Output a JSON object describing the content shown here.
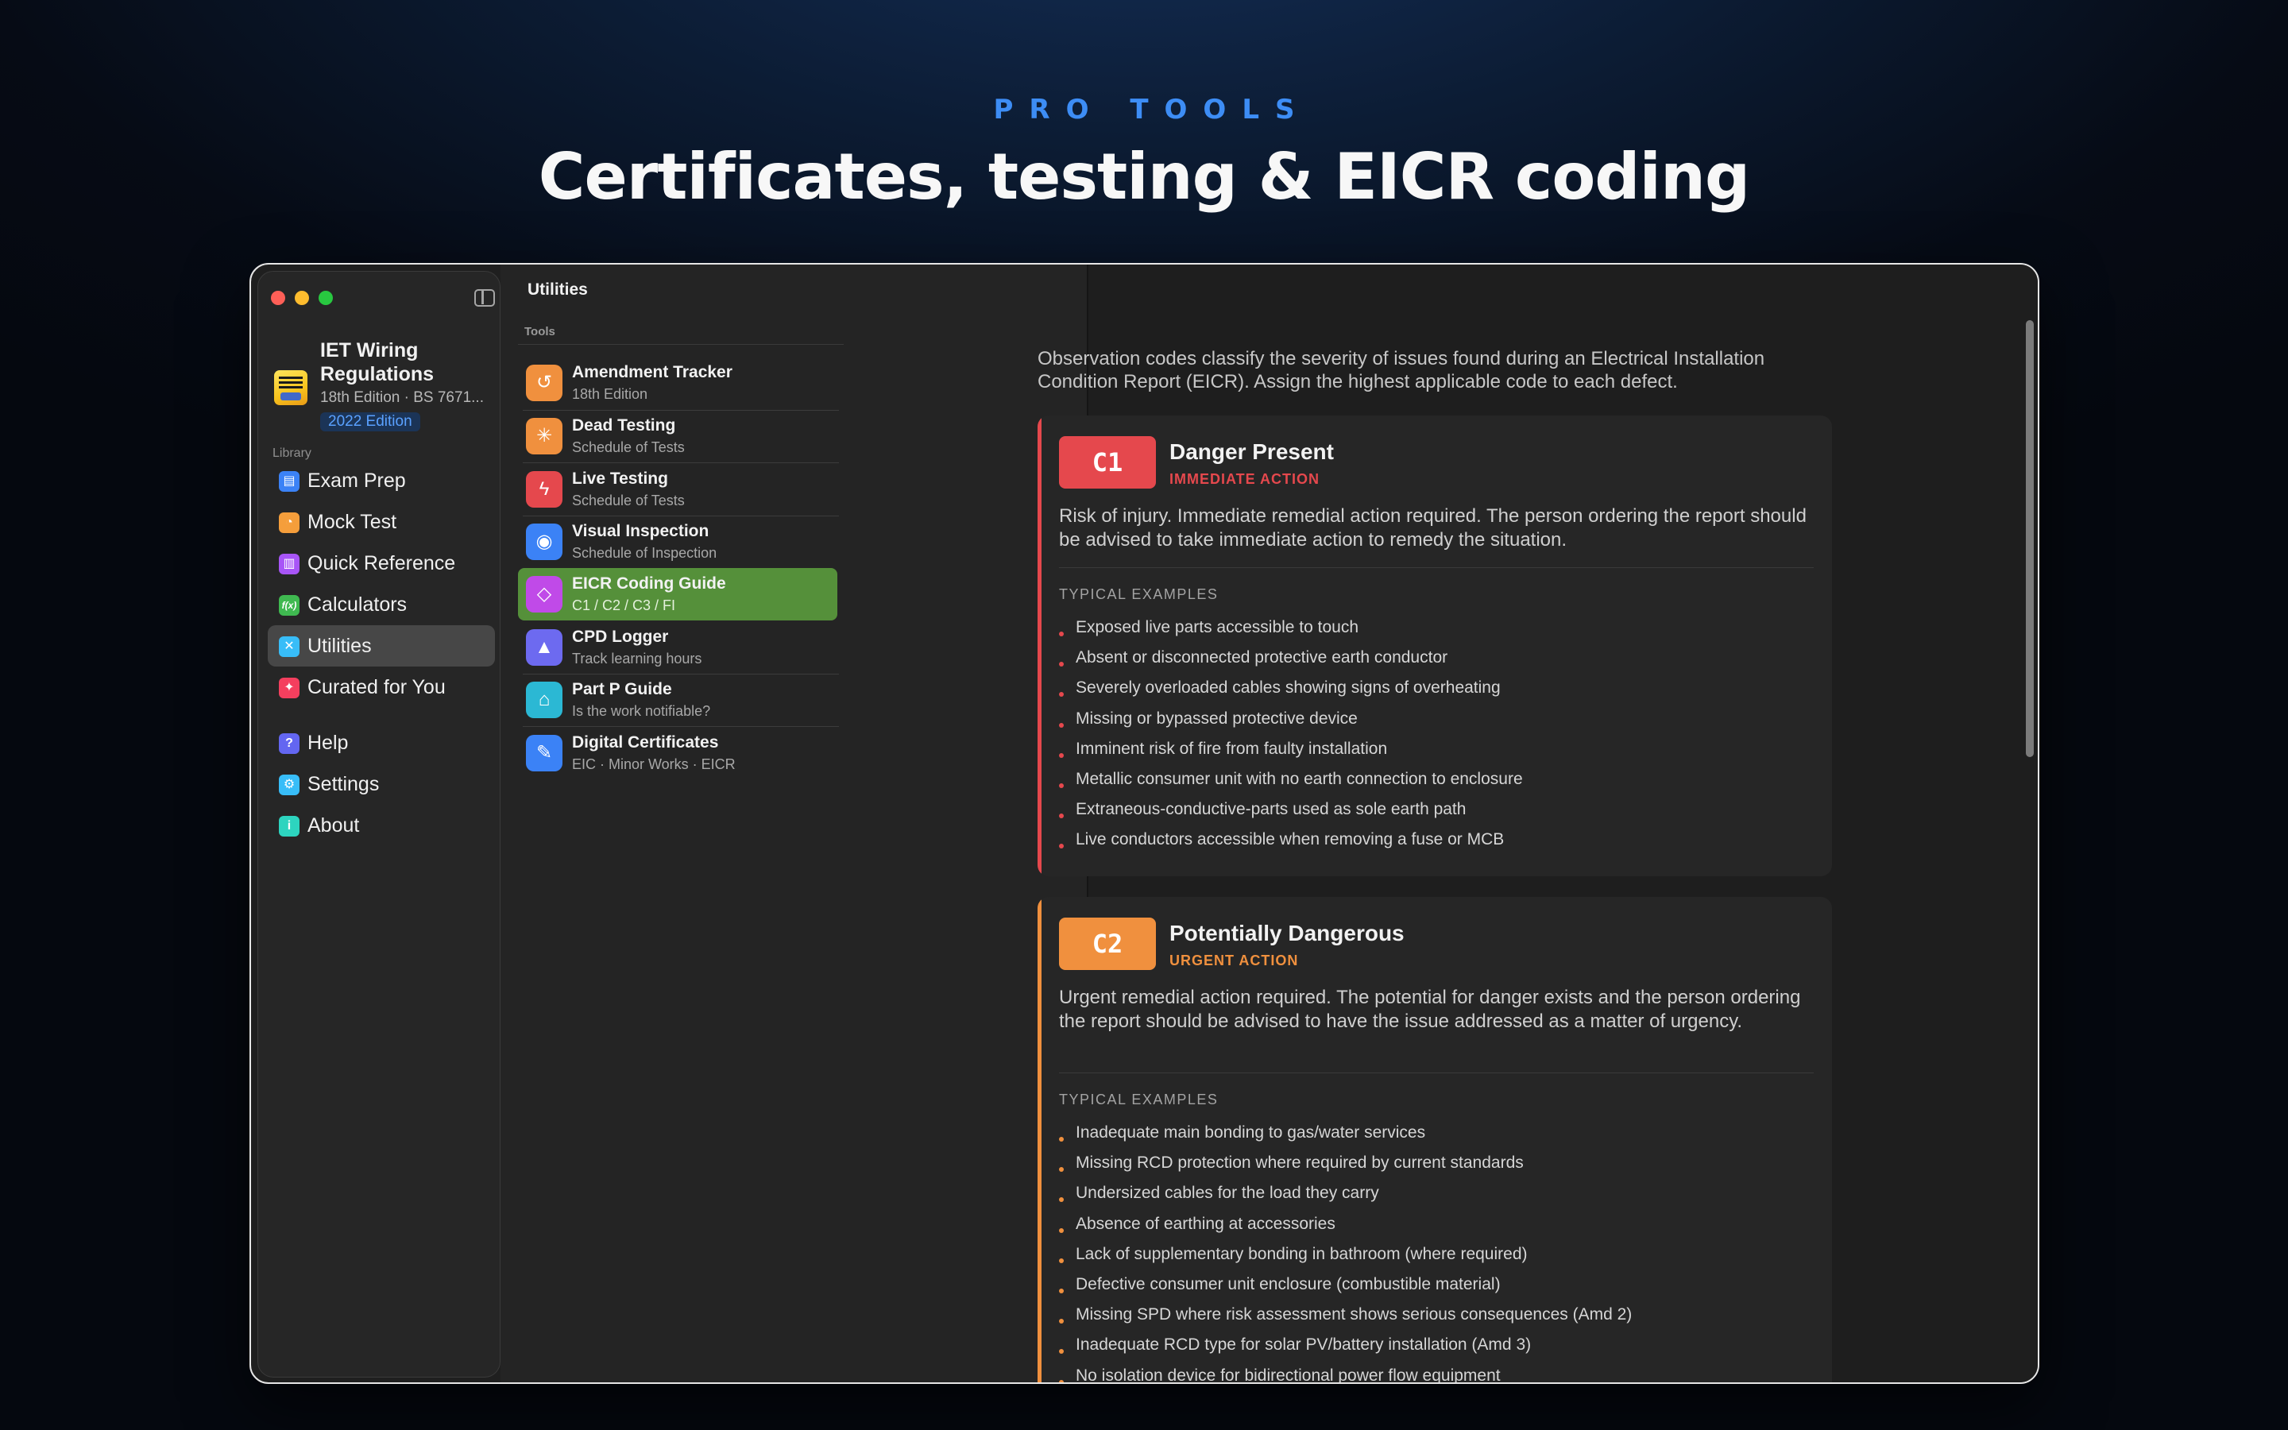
{
  "hero": {
    "eyebrow": "PRO TOOLS",
    "title": "Certificates, testing & EICR coding"
  },
  "sidebar": {
    "book": {
      "title": "IET Wiring Regulations",
      "subtitle": "18th Edition · BS 7671...",
      "badge": "2022 Edition"
    },
    "library_label": "Library",
    "items": [
      {
        "label": "Exam Prep",
        "icon": "clipboard-icon",
        "color": "#3b82f6"
      },
      {
        "label": "Mock Test",
        "icon": "timer-icon",
        "color": "#f59e3b"
      },
      {
        "label": "Quick Reference",
        "icon": "chart-icon",
        "color": "#a855f7"
      },
      {
        "label": "Calculators",
        "icon": "function-icon",
        "color": "#3fb950"
      },
      {
        "label": "Utilities",
        "icon": "tools-icon",
        "color": "#38bdf8"
      },
      {
        "label": "Curated for You",
        "icon": "sparkle-icon",
        "color": "#f43f5e"
      }
    ],
    "footer_items": [
      {
        "label": "Help",
        "icon": "question-icon",
        "color": "#6366f1"
      },
      {
        "label": "Settings",
        "icon": "gear-icon",
        "color": "#38bdf8"
      },
      {
        "label": "About",
        "icon": "info-icon",
        "color": "#2dd4bf"
      }
    ]
  },
  "tools": {
    "title": "Utilities",
    "section": "Tools",
    "items": [
      {
        "name": "Amendment Tracker",
        "sub": "18th Edition",
        "icon": "history-icon",
        "color": "#f0903e"
      },
      {
        "name": "Dead Testing",
        "sub": "Schedule of Tests",
        "icon": "sparkle-icon",
        "color": "#f0903e"
      },
      {
        "name": "Live Testing",
        "sub": "Schedule of Tests",
        "icon": "bolt-icon",
        "color": "#e5484d"
      },
      {
        "name": "Visual Inspection",
        "sub": "Schedule of Inspection",
        "icon": "eye-icon",
        "color": "#3b82f6"
      },
      {
        "name": "EICR Coding Guide",
        "sub": "C1 / C2 / C3 / FI",
        "icon": "tag-icon",
        "color": "#c04ae8"
      },
      {
        "name": "CPD Logger",
        "sub": "Track learning hours",
        "icon": "graduation-cap-icon",
        "color": "#6d6af0"
      },
      {
        "name": "Part P Guide",
        "sub": "Is the work notifiable?",
        "icon": "building-icon",
        "color": "#2bb8d4"
      },
      {
        "name": "Digital Certificates",
        "sub": "EIC · Minor Works · EICR",
        "icon": "signature-icon",
        "color": "#3b82f6"
      }
    ]
  },
  "content": {
    "intro": "Observation codes classify the severity of issues found during an Electrical Installation Condition Report (EICR). Assign the highest applicable code to each defect.",
    "cards": [
      {
        "code": "C1",
        "title": "Danger Present",
        "subtitle": "IMMEDIATE ACTION",
        "color": "#e5484d",
        "description": "Risk of injury. Immediate remedial action required. The person ordering the report should be advised to take immediate action to remedy the situation.",
        "examples_label": "TYPICAL EXAMPLES",
        "examples": [
          "Exposed live parts accessible to touch",
          "Absent or disconnected protective earth conductor",
          "Severely overloaded cables showing signs of overheating",
          "Missing or bypassed protective device",
          "Imminent risk of fire from faulty installation",
          "Metallic consumer unit with no earth connection to enclosure",
          "Extraneous-conductive-parts used as sole earth path",
          "Live conductors accessible when removing a fuse or MCB"
        ]
      },
      {
        "code": "C2",
        "title": "Potentially Dangerous",
        "subtitle": "URGENT ACTION",
        "color": "#f0903e",
        "description": "Urgent remedial action required. The potential for danger exists and the person ordering the report should be advised to have the issue addressed as a matter of urgency.",
        "examples_label": "TYPICAL EXAMPLES",
        "examples": [
          "Inadequate main bonding to gas/water services",
          "Missing RCD protection where required by current standards",
          "Undersized cables for the load they carry",
          "Absence of earthing at accessories",
          "Lack of supplementary bonding in bathroom (where required)",
          "Defective consumer unit enclosure (combustible material)",
          "Missing SPD where risk assessment shows serious consequences (Amd 2)",
          "Inadequate RCD type for solar PV/battery installation (Amd 3)",
          "No isolation device for bidirectional power flow equipment"
        ]
      }
    ]
  },
  "colors": {
    "selected_tool": "#55903a",
    "accent": "#3d8df5"
  }
}
